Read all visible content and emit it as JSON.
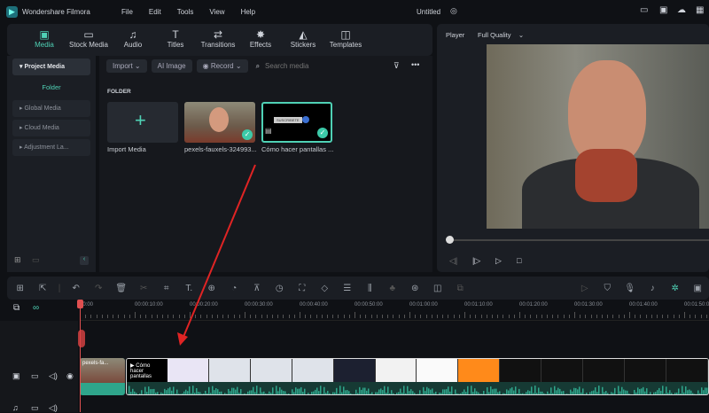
{
  "app": {
    "title": "Wondershare Filmora",
    "menu": [
      "File",
      "Edit",
      "Tools",
      "View",
      "Help"
    ],
    "project": "Untitled"
  },
  "tabs": [
    {
      "label": "Media",
      "icon": "media-icon"
    },
    {
      "label": "Stock Media",
      "icon": "folder-icon"
    },
    {
      "label": "Audio",
      "icon": "music-icon"
    },
    {
      "label": "Titles",
      "icon": "text-icon"
    },
    {
      "label": "Transitions",
      "icon": "transition-icon"
    },
    {
      "label": "Effects",
      "icon": "effects-icon"
    },
    {
      "label": "Stickers",
      "icon": "sticker-icon"
    },
    {
      "label": "Templates",
      "icon": "template-icon"
    }
  ],
  "sidebar": {
    "items": [
      "Project Media",
      "Folder",
      "Global Media",
      "Cloud Media",
      "Adjustment La..."
    ]
  },
  "media_toolbar": {
    "import": "Import",
    "ai_image": "AI Image",
    "record": "Record",
    "search_placeholder": "Search media"
  },
  "media": {
    "section": "FOLDER",
    "items": [
      {
        "label": "Import Media"
      },
      {
        "label": "pexels-fauxels-324993..."
      },
      {
        "label": "Cómo hacer pantallas ...",
        "badge": "SUSCRIBETE"
      }
    ]
  },
  "player": {
    "label": "Player",
    "quality": "Full Quality",
    "progress": 0
  },
  "ruler": [
    "00:00",
    "00:00:10:00",
    "00:00:20:00",
    "00:00:30:00",
    "00:00:40:00",
    "00:00:50:00",
    "00:01:00:00",
    "00:01:10:00",
    "00:01:20:00",
    "00:01:30:00",
    "00:01:40:00",
    "00:01:50:00"
  ],
  "timeline": {
    "clip1": "pexels-fa...",
    "clip2": "Cómo hacer pantallas"
  },
  "colors": {
    "accent": "#4fd1b5",
    "arrow": "#e02424",
    "playhead": "#e05050",
    "waveform": "#2fa58b"
  }
}
